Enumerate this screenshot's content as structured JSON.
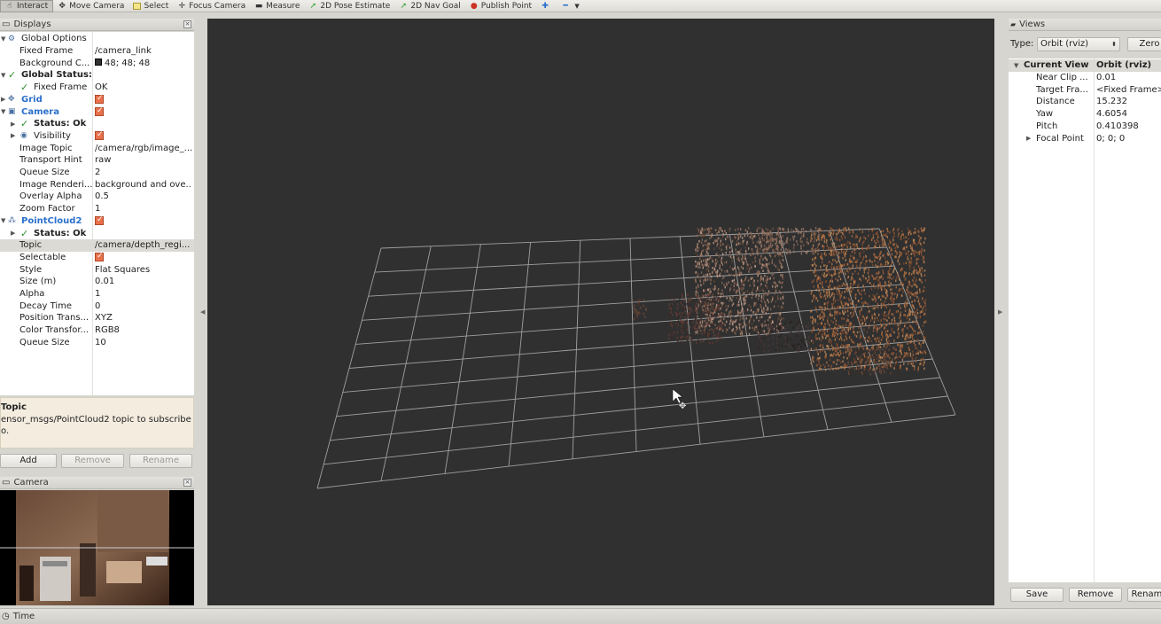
{
  "toolbar": {
    "tools": [
      {
        "label": "Interact",
        "icon": "interact-icon"
      },
      {
        "label": "Move Camera",
        "icon": "move-camera-icon"
      },
      {
        "label": "Select",
        "icon": "select-icon"
      },
      {
        "label": "Focus Camera",
        "icon": "focus-camera-icon"
      },
      {
        "label": "Measure",
        "icon": "measure-icon"
      },
      {
        "label": "2D Pose Estimate",
        "icon": "pose-estimate-icon"
      },
      {
        "label": "2D Nav Goal",
        "icon": "nav-goal-icon"
      },
      {
        "label": "Publish Point",
        "icon": "publish-point-icon"
      }
    ]
  },
  "displays": {
    "title": "Displays",
    "rows": [
      {
        "name": "Global Options",
        "value": ""
      },
      {
        "name": "Fixed Frame",
        "value": "/camera_link"
      },
      {
        "name": "Background C...",
        "value": "48; 48; 48"
      },
      {
        "name": "Global Status:...",
        "value": ""
      },
      {
        "name": "Fixed Frame",
        "value": "OK"
      },
      {
        "name": "Grid",
        "value": ""
      },
      {
        "name": "Camera",
        "value": ""
      },
      {
        "name": "Status: Ok",
        "value": ""
      },
      {
        "name": "Visibility",
        "value": ""
      },
      {
        "name": "Image Topic",
        "value": "/camera/rgb/image_..."
      },
      {
        "name": "Transport Hint",
        "value": "raw"
      },
      {
        "name": "Queue Size",
        "value": "2"
      },
      {
        "name": "Image Renderi...",
        "value": "background and ove..."
      },
      {
        "name": "Overlay Alpha",
        "value": "0.5"
      },
      {
        "name": "Zoom Factor",
        "value": "1"
      },
      {
        "name": "PointCloud2",
        "value": ""
      },
      {
        "name": "Status: Ok",
        "value": ""
      },
      {
        "name": "Topic",
        "value": "/camera/depth_regi..."
      },
      {
        "name": "Selectable",
        "value": ""
      },
      {
        "name": "Style",
        "value": "Flat Squares"
      },
      {
        "name": "Size (m)",
        "value": "0.01"
      },
      {
        "name": "Alpha",
        "value": "1"
      },
      {
        "name": "Decay Time",
        "value": "0"
      },
      {
        "name": "Position Trans...",
        "value": "XYZ"
      },
      {
        "name": "Color Transfor...",
        "value": "RGB8"
      },
      {
        "name": "Queue Size",
        "value": "10"
      }
    ],
    "background_color": "#303030",
    "description_title": "Topic",
    "description_text": "ensor_msgs/PointCloud2 topic to subscribe o.",
    "add_label": "Add",
    "remove_label": "Remove",
    "rename_label": "Rename"
  },
  "camera_panel": {
    "title": "Camera"
  },
  "views": {
    "title": "Views",
    "type_label": "Type:",
    "type_value": "Orbit (rviz)",
    "zero_label": "Zero",
    "rows": [
      {
        "name": "Current View",
        "value": "Orbit (rviz)"
      },
      {
        "name": "Near Clip ...",
        "value": "0.01"
      },
      {
        "name": "Target Fra...",
        "value": "<Fixed Frame>"
      },
      {
        "name": "Distance",
        "value": "15.232"
      },
      {
        "name": "Yaw",
        "value": "4.6054"
      },
      {
        "name": "Pitch",
        "value": "0.410398"
      },
      {
        "name": "Focal Point",
        "value": "0; 0; 0"
      }
    ],
    "save_label": "Save",
    "remove_label": "Remove",
    "rename_label": "Rename"
  },
  "time": {
    "title": "Time"
  },
  "colors": {
    "accent": "#2a6fcb",
    "viewport_bg": "#303030",
    "checkbox": "#e8704a"
  }
}
